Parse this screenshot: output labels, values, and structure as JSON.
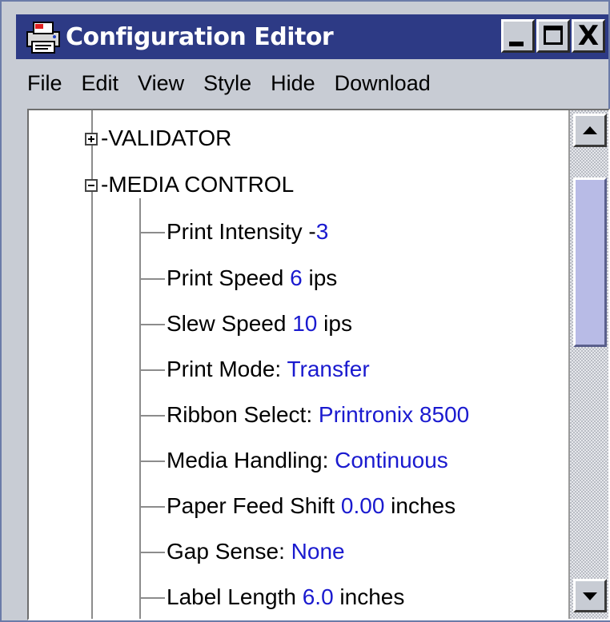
{
  "window": {
    "title": "Configuration Editor",
    "icon": "printer-app-icon",
    "buttons": [
      "minimize-icon",
      "maximize-icon",
      "close-icon"
    ],
    "close_glyph": "X"
  },
  "menu": [
    "File",
    "Edit",
    "View",
    "Style",
    "Hide",
    "Download"
  ],
  "tree": {
    "nodes": [
      {
        "label": "VALIDATOR",
        "expander": "+",
        "expanded": false
      },
      {
        "label": "MEDIA CONTROL",
        "expander": "−",
        "expanded": true
      }
    ],
    "dash": "-",
    "children": [
      {
        "label": "Print Intensity -",
        "value": "3",
        "suffix": ""
      },
      {
        "label": "Print Speed ",
        "value": "6",
        "suffix": " ips"
      },
      {
        "label": "Slew Speed ",
        "value": "10",
        "suffix": " ips"
      },
      {
        "label": "Print Mode: ",
        "value": "Transfer",
        "suffix": ""
      },
      {
        "label": "Ribbon Select: ",
        "value": "Printronix 8500",
        "suffix": ""
      },
      {
        "label": "Media Handling: ",
        "value": "Continuous",
        "suffix": ""
      },
      {
        "label": "Paper Feed Shift ",
        "value": "0.00",
        "suffix": " inches"
      },
      {
        "label": "Gap Sense: ",
        "value": "None",
        "suffix": ""
      },
      {
        "label": "Label Length ",
        "value": "6.0",
        "suffix": " inches"
      }
    ]
  },
  "scrollbar": {
    "up_icon": "scroll-up-arrow-icon",
    "down_icon": "scroll-down-arrow-icon",
    "position": 0.0
  },
  "colors": {
    "titlebar": "#2d3a85",
    "value_text": "#1a1acf",
    "chrome": "#c8ccd4",
    "scroll_thumb": "#b8bbe6"
  }
}
